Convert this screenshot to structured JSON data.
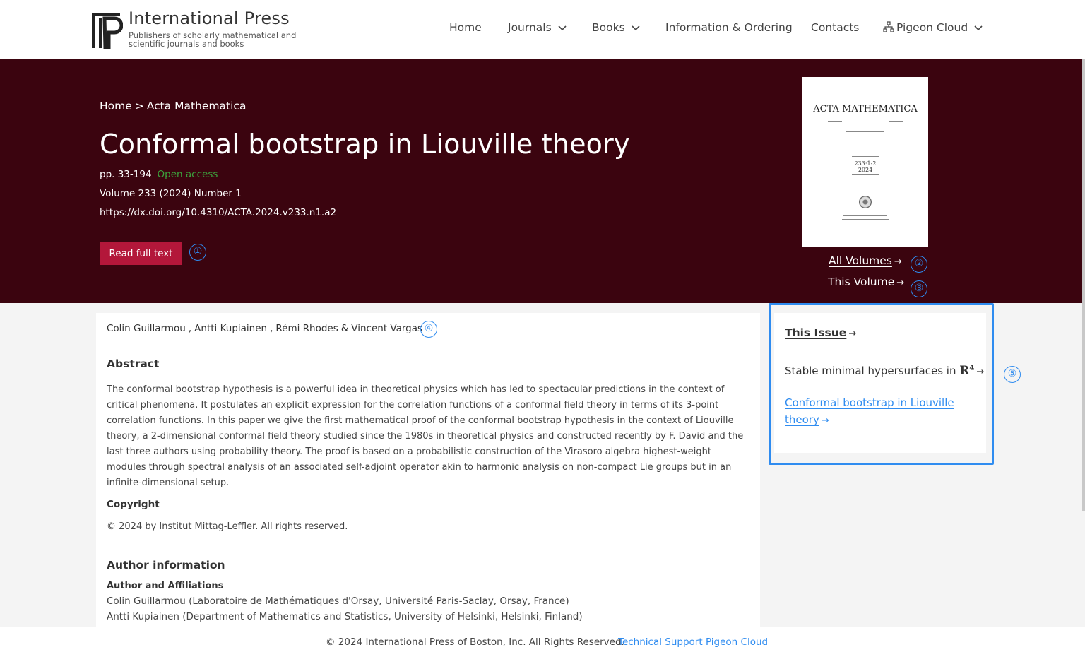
{
  "brand": {
    "name": "International Press",
    "tagline": "Publishers of scholarly mathematical and scientific journals and books"
  },
  "nav": {
    "home": "Home",
    "journals": "Journals",
    "books": "Books",
    "info": "Information & Ordering",
    "contacts": "Contacts",
    "pigeon": "Pigeon Cloud"
  },
  "breadcrumb": {
    "home": "Home",
    "sep": ">",
    "journal": "Acta Mathematica"
  },
  "article": {
    "title": "Conformal bootstrap in Liouville theory",
    "pages": "pp. 33-194",
    "access": "Open access",
    "volume": "Volume 233 (2024) Number 1",
    "doi": "https://dx.doi.org/10.4310/ACTA.2024.v233.n1.a2",
    "read_button": "Read full text"
  },
  "cover": {
    "title": "ACTA MATHEMATICA",
    "volume_mark": "233:1-2",
    "year": "2024"
  },
  "side_links": {
    "all_volumes": "All Volumes",
    "this_volume": "This Volume"
  },
  "markers": [
    "①",
    "②",
    "③",
    "④",
    "⑤"
  ],
  "authors": [
    "Colin Guillarmou",
    "Antti Kupiainen",
    "Rémi Rhodes",
    "Vincent Vargas"
  ],
  "author_joiners": [
    ",",
    ",",
    "&"
  ],
  "abstract": {
    "heading": "Abstract",
    "text": "The conformal bootstrap hypothesis is a powerful idea in theoretical physics which has led to spectacular predictions in the context of critical phenomena. It postulates an explicit expression for the correlation functions of a conformal field theory in terms of its 3-point correlation functions. In this paper we give the first mathematical proof of the conformal bootstrap hypothesis in the context of Liouville theory, a 2-dimensional conformal field theory studied since the 1980s in theoretical physics and constructed recently by F. David and the last three authors using probability theory. The proof is based on a probabilistic construction of the Virasoro algebra highest-weight modules through spectral analysis of an associated self-adjoint operator akin to harmonic analysis on non-compact Lie groups but in an infinite-dimensional setup."
  },
  "copyright": {
    "heading": "Copyright",
    "text": "© 2024 by Institut Mittag-Leffler. All rights reserved."
  },
  "author_info": {
    "heading": "Author information",
    "subheading": "Author and Affiliations",
    "affiliations": [
      "Colin Guillarmou  (Laboratoire de Mathématiques d'Orsay, Université Paris-Saclay, Orsay, France)",
      "Antti Kupiainen  (Department of Mathematics and Statistics, University of Helsinki, Helsinki, Finland)"
    ]
  },
  "issue_panel": {
    "heading": "This Issue",
    "link1_text": "Stable minimal hypersurfaces in ",
    "link1_math": "R",
    "link1_exp": "4",
    "link2": "Conformal bootstrap in Liouville theory"
  },
  "footer": {
    "text": "© 2024 International Press of Boston, Inc. All Rights Reserved.",
    "link": "Technical Support Pigeon Cloud"
  },
  "colors": {
    "hero_bg": "#3b040f",
    "button": "#b3173a",
    "accent": "#2f8cf0",
    "open_access": "#3ca23c"
  }
}
